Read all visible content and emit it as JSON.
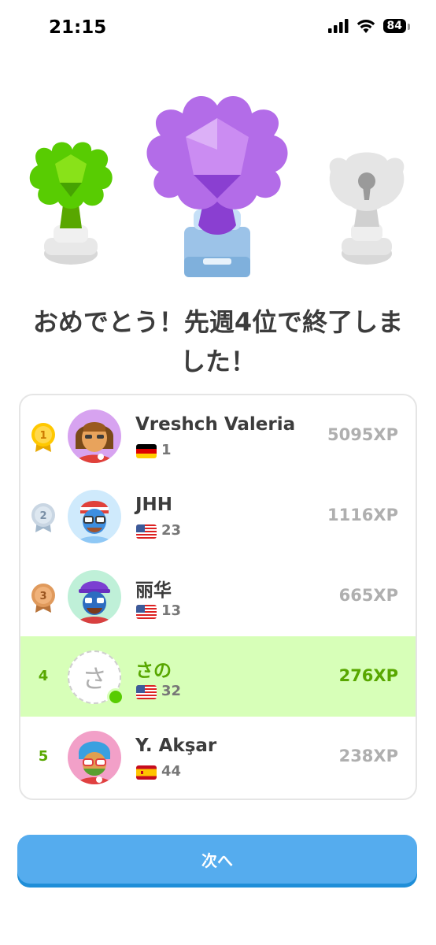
{
  "status_bar": {
    "time": "21:15",
    "battery": "84",
    "icons": [
      "signal-icon",
      "wifi-icon",
      "battery-icon"
    ]
  },
  "trophies": {
    "icons": [
      "green-trophy-icon",
      "purple-trophy-icon",
      "locked-trophy-icon"
    ],
    "colors": {
      "green": "#58cc02",
      "purple": "#9b51e0",
      "gray": "#e5e5e5"
    }
  },
  "headline": "おめでとう！先週4位で終了しました！",
  "leaderboard": {
    "rows": [
      {
        "rank": "1",
        "name": "Vreshch Valeria",
        "flag": "germany-flag",
        "count": "1",
        "xp": "5095XP",
        "medal": "gold"
      },
      {
        "rank": "2",
        "name": "JHH",
        "flag": "usa-flag",
        "count": "23",
        "xp": "1116XP",
        "medal": "silver"
      },
      {
        "rank": "3",
        "name": "丽华",
        "flag": "usa-flag",
        "count": "13",
        "xp": "665XP",
        "medal": "bronze"
      },
      {
        "rank": "4",
        "name": "さの",
        "avatar_letter": "さ",
        "flag": "usa-flag",
        "count": "32",
        "xp": "276XP",
        "current": true
      },
      {
        "rank": "5",
        "name": "Y. Akşar",
        "flag": "spain-flag",
        "count": "44",
        "xp": "238XP"
      }
    ],
    "highlight_color": "#d7ffb8",
    "accent_color": "#58a700"
  },
  "next_button": {
    "label": "次へ",
    "color": "#55acee"
  }
}
